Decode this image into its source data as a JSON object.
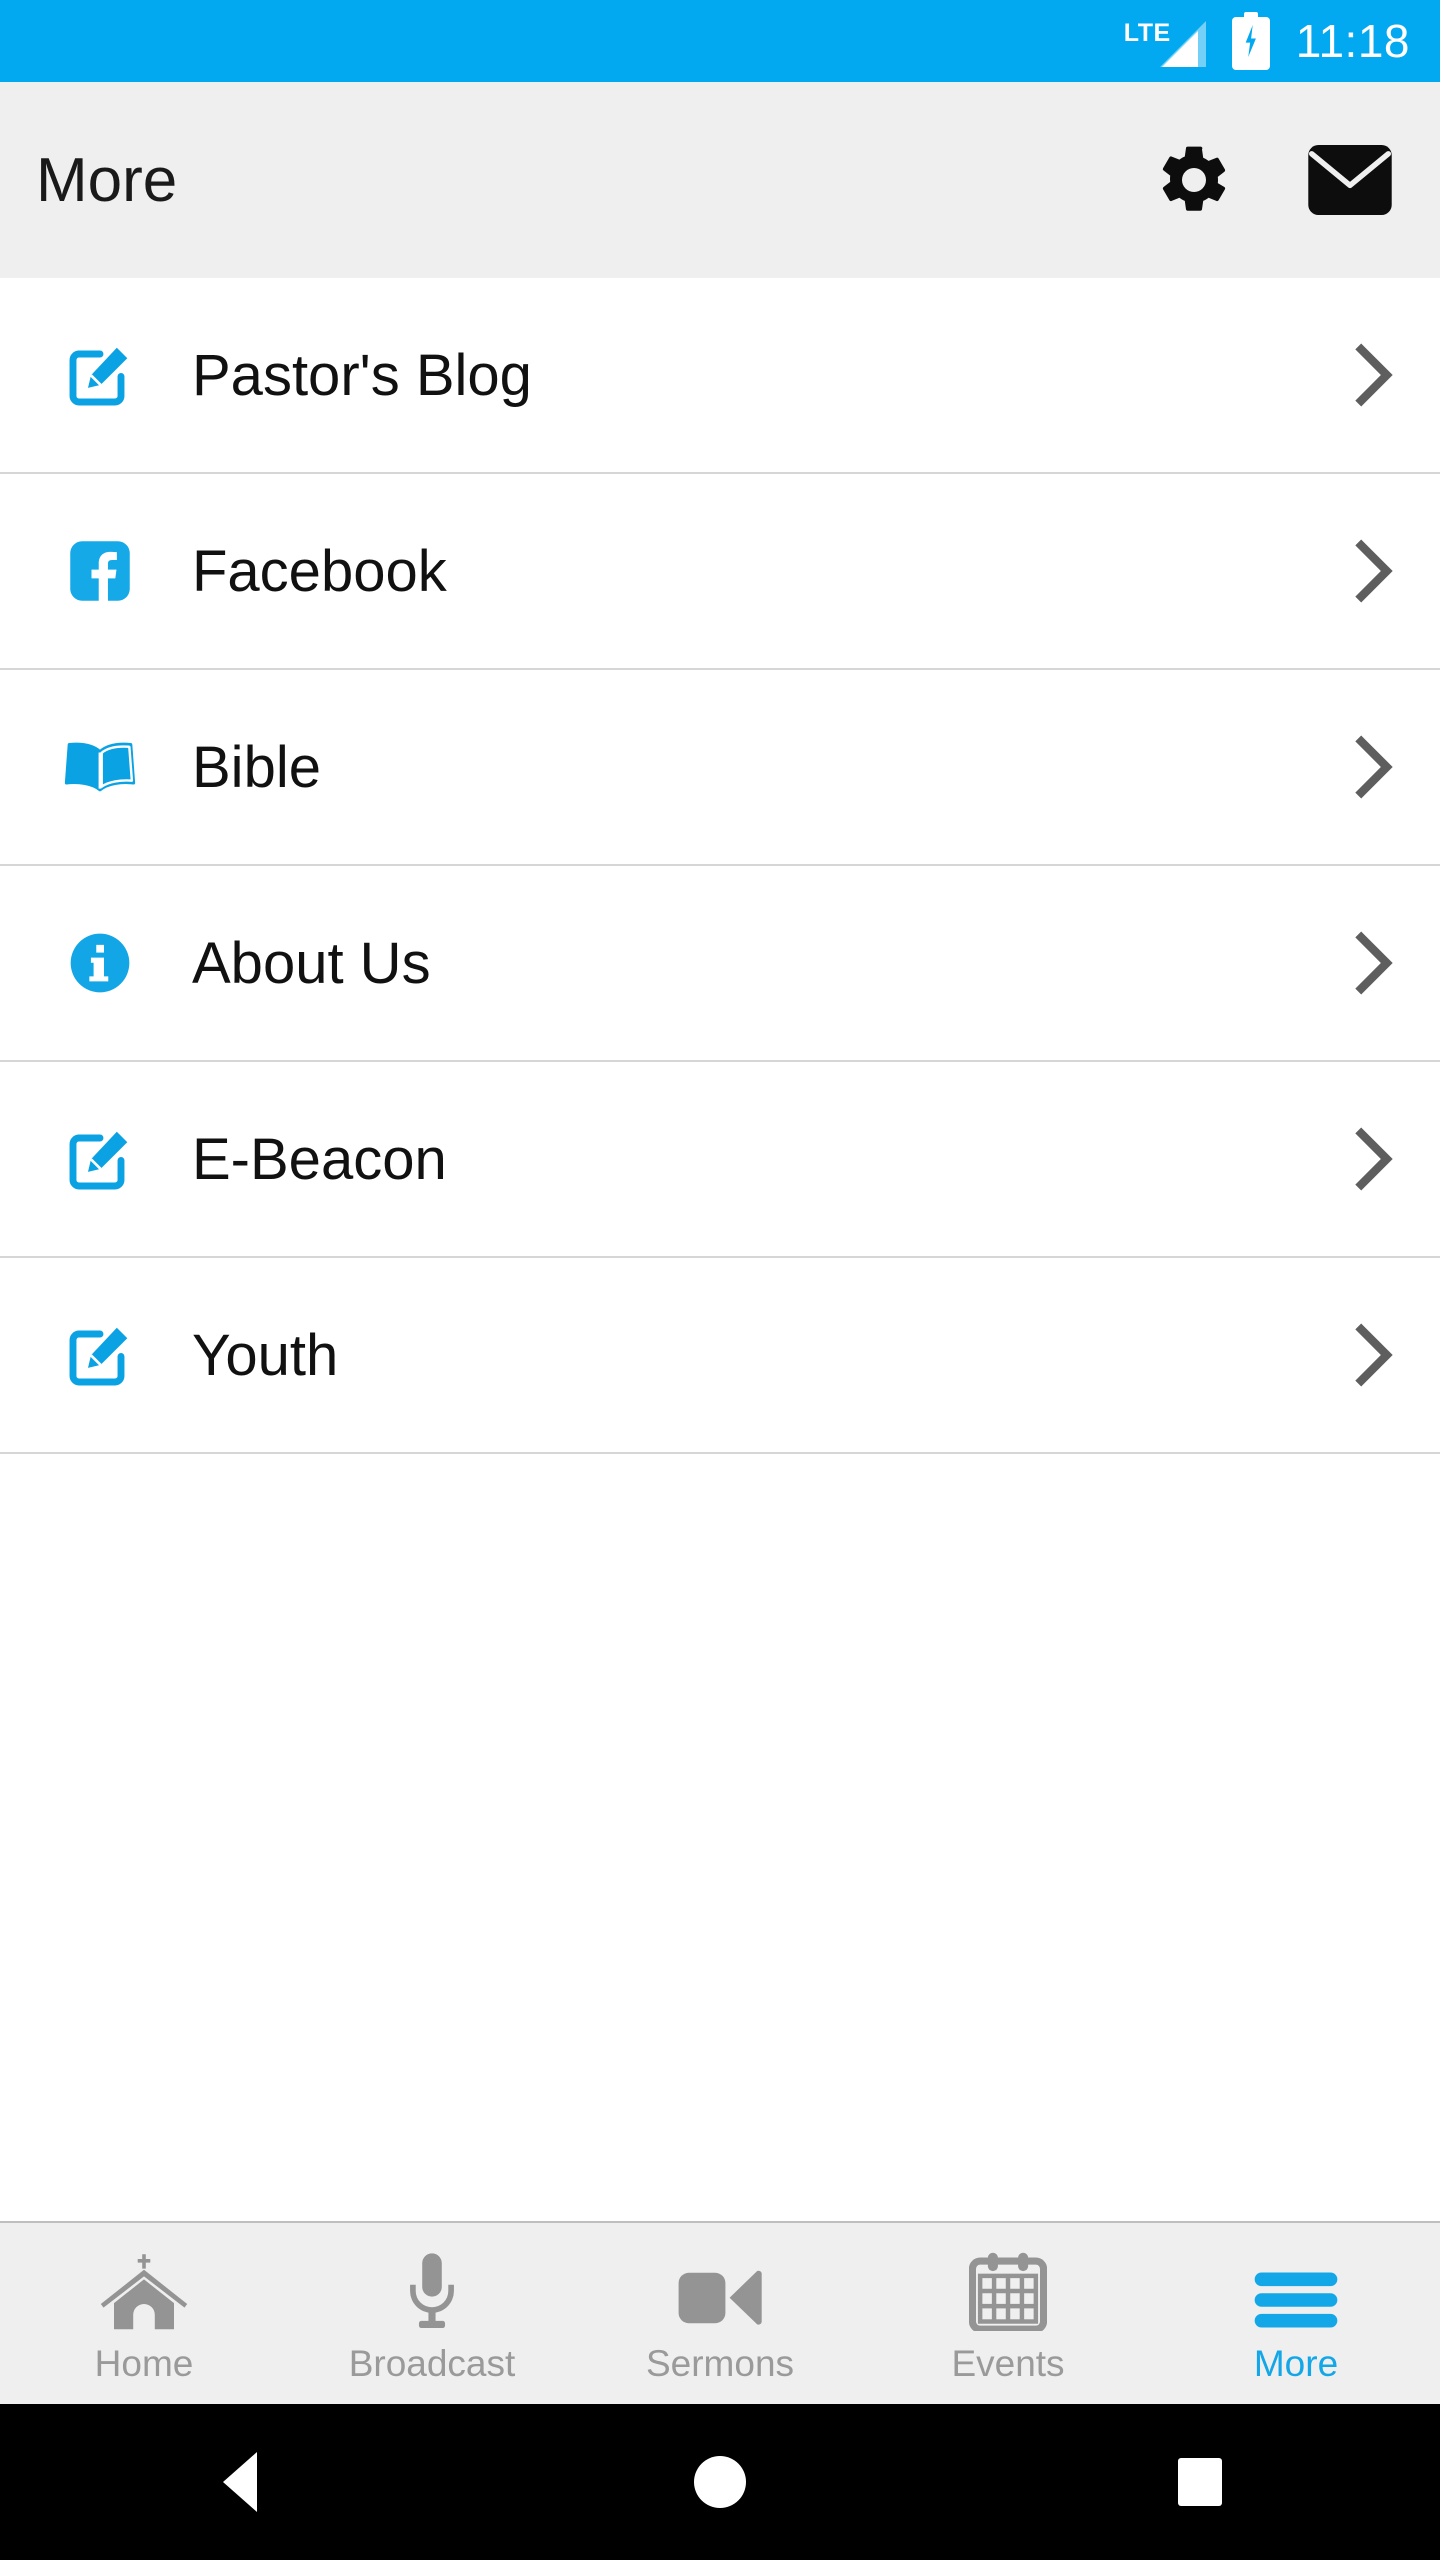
{
  "status_bar": {
    "network_label": "LTE",
    "signal_icon": "signal-bars-icon",
    "battery_icon": "battery-charging-icon",
    "time": "11:18",
    "background_color": "#03A9F0"
  },
  "header": {
    "title": "More",
    "background_color": "#EFEFEF",
    "actions": [
      {
        "name": "settings-button",
        "icon": "gear-icon"
      },
      {
        "name": "mail-button",
        "icon": "envelope-icon"
      }
    ]
  },
  "accent_color": "#03A9F0",
  "list": {
    "items": [
      {
        "label": "Pastor's Blog",
        "icon": "edit-pencil-icon",
        "chevron": "chevron-right-icon"
      },
      {
        "label": "Facebook",
        "icon": "facebook-icon",
        "chevron": "chevron-right-icon"
      },
      {
        "label": "Bible",
        "icon": "open-book-icon",
        "chevron": "chevron-right-icon"
      },
      {
        "label": "About Us",
        "icon": "info-circle-icon",
        "chevron": "chevron-right-icon"
      },
      {
        "label": "E-Beacon",
        "icon": "edit-pencil-icon",
        "chevron": "chevron-right-icon"
      },
      {
        "label": "Youth",
        "icon": "edit-pencil-icon",
        "chevron": "chevron-right-icon"
      }
    ]
  },
  "tabbar": {
    "active_index": 4,
    "active_color": "#13A7E8",
    "inactive_color": "#9A9A9A",
    "tabs": [
      {
        "label": "Home",
        "icon": "church-icon"
      },
      {
        "label": "Broadcast",
        "icon": "microphone-icon"
      },
      {
        "label": "Sermons",
        "icon": "video-camera-icon"
      },
      {
        "label": "Events",
        "icon": "calendar-icon"
      },
      {
        "label": "More",
        "icon": "hamburger-menu-icon"
      }
    ]
  },
  "system_navbar": {
    "buttons": [
      {
        "name": "back-button",
        "icon": "triangle-back-icon"
      },
      {
        "name": "home-button",
        "icon": "circle-home-icon"
      },
      {
        "name": "recents-button",
        "icon": "square-recents-icon"
      }
    ]
  }
}
